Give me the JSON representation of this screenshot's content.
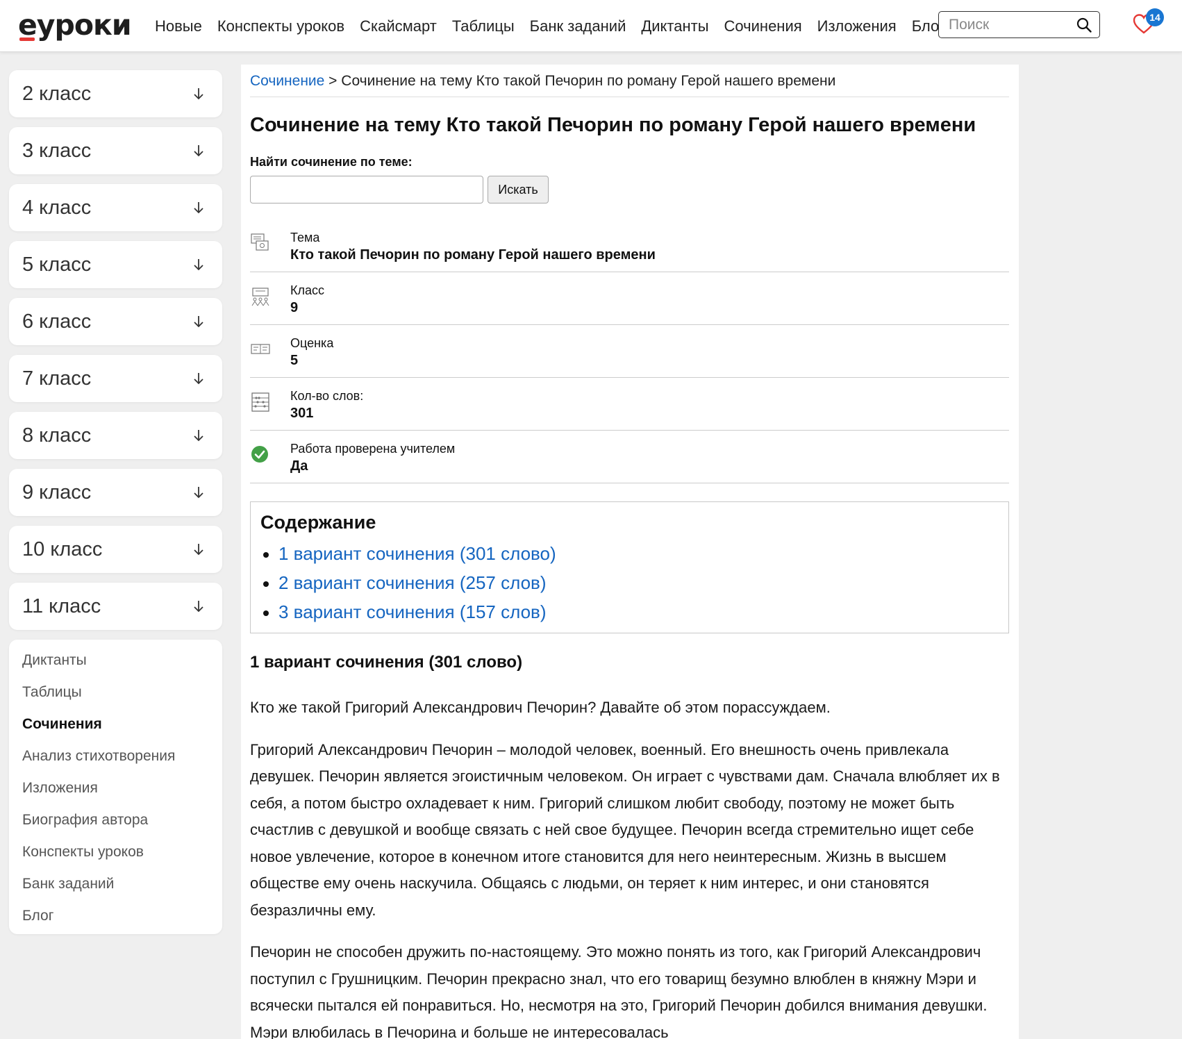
{
  "header": {
    "logo": "еуроки",
    "nav": [
      "Новые",
      "Конспекты уроков",
      "Скайсмарт",
      "Таблицы",
      "Банк заданий",
      "Диктанты",
      "Сочинения",
      "Изложения",
      "Блог"
    ],
    "search_placeholder": "Поиск",
    "favorites_count": "14",
    "accent_color": "#e53935",
    "badge_color": "#1976d2"
  },
  "sidebar": {
    "grades": [
      "2 класс",
      "3 класс",
      "4 класс",
      "5 класс",
      "6 класс",
      "7 класс",
      "8 класс",
      "9 класс",
      "10 класс",
      "11 класс"
    ],
    "links": [
      {
        "label": "Диктанты",
        "active": false
      },
      {
        "label": "Таблицы",
        "active": false
      },
      {
        "label": "Сочинения",
        "active": true
      },
      {
        "label": "Анализ стихотворения",
        "active": false
      },
      {
        "label": "Изложения",
        "active": false
      },
      {
        "label": "Биография автора",
        "active": false
      },
      {
        "label": "Конспекты уроков",
        "active": false
      },
      {
        "label": "Банк заданий",
        "active": false
      },
      {
        "label": "Блог",
        "active": false
      }
    ]
  },
  "main": {
    "breadcrumb": {
      "link": "Сочинение",
      "separator": " > ",
      "current": "Сочинение на тему Кто такой Печорин по роману Герой нашего времени"
    },
    "title": "Сочинение на тему Кто такой Печорин по роману Герой нашего времени",
    "find": {
      "label": "Найти сочинение по теме:",
      "value": "",
      "button": "Искать"
    },
    "meta": [
      {
        "icon": "topic-icon",
        "label": "Тема",
        "value": "Кто такой Печорин по роману Герой нашего времени"
      },
      {
        "icon": "classroom-icon",
        "label": "Класс",
        "value": "9"
      },
      {
        "icon": "grade-card-icon",
        "label": "Оценка",
        "value": "5"
      },
      {
        "icon": "abacus-icon",
        "label": "Кол-во слов:",
        "value": "301"
      },
      {
        "icon": "check-circle-icon",
        "label": "Работа проверена учителем",
        "value": "Да"
      }
    ],
    "toc": {
      "title": "Содержание",
      "items": [
        "1 вариант сочинения (301 слово)",
        "2 вариант сочинения (257 слов)",
        "3 вариант сочинения (157 слов)"
      ]
    },
    "essay_heading": "1 вариант сочинения (301 слово)",
    "paragraphs": [
      "Кто же такой Григорий Александрович Печорин? Давайте об этом порассуждаем.",
      "Григорий Александрович Печорин – молодой человек, военный. Его внешность очень привлекала девушек. Печорин является эгоистичным человеком. Он играет с чувствами дам. Сначала влюбляет их в себя, а потом быстро охладевает к ним. Григорий слишком любит свободу, поэтому не может быть счастлив с девушкой и вообще связать с ней свое будущее. Печорин всегда стремительно ищет себе новое увлечение, которое в конечном итоге становится для него неинтересным. Жизнь в высшем обществе ему очень наскучила. Общаясь с людьми, он теряет к ним интерес, и они становятся безразличны ему.",
      "Печорин не способен дружить по-настоящему. Это можно понять из того, как Григорий Александрович поступил с Грушницким. Печорин прекрасно знал, что его товарищ безумно влюблен в княжну Мэри и всячески пытался ей понравиться. Но, несмотря на это, Григорий Печорин добился внимания девушки. Мэри влюбилась в Печорина и больше не интересовалась"
    ]
  }
}
